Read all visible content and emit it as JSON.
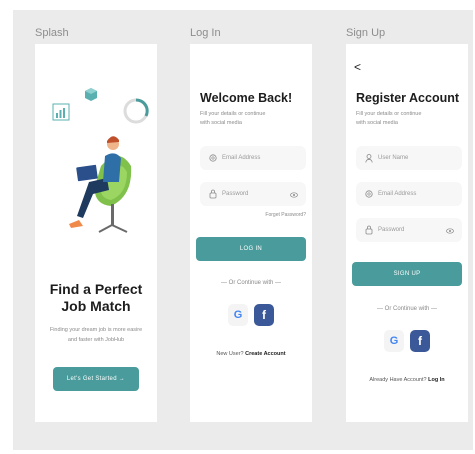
{
  "frames": {
    "splash": "Splash",
    "login": "Log In",
    "signup": "Sign Up"
  },
  "splash": {
    "title_line1": "Find a Perfect",
    "title_line2": "Job Match",
    "subtitle_line1": "Finding your dream job is more easire",
    "subtitle_line2": "and faster with JobHub",
    "cta": "Let's Get Started →"
  },
  "login": {
    "heading": "Welcome Back!",
    "sub_line1": "Fill your details or continue",
    "sub_line2": "with social media",
    "email_placeholder": "Email Address",
    "password_placeholder": "Password",
    "forgot": "Forget Password?",
    "button": "LOG IN",
    "or": "— Or Continue with —",
    "footer_text": "New User?",
    "footer_link": "Create Account"
  },
  "signup": {
    "back": "<",
    "heading": "Register Account",
    "sub_line1": "Fill your details or continue",
    "sub_line2": "with social media",
    "username_placeholder": "User Name",
    "email_placeholder": "Email Address",
    "password_placeholder": "Password",
    "button": "SIGN UP",
    "or": "— Or Continue with —",
    "footer_text": "Already Have Account?",
    "footer_link": "Log In"
  },
  "colors": {
    "accent": "#4a9b9b",
    "facebook": "#3b5998",
    "canvas": "#ebebeb"
  },
  "icons": [
    "chart-icon",
    "cube-icon",
    "progress-ring-icon",
    "user-icon",
    "mail-icon",
    "lock-icon",
    "eye-icon",
    "google-icon",
    "facebook-icon",
    "back-arrow-icon"
  ]
}
